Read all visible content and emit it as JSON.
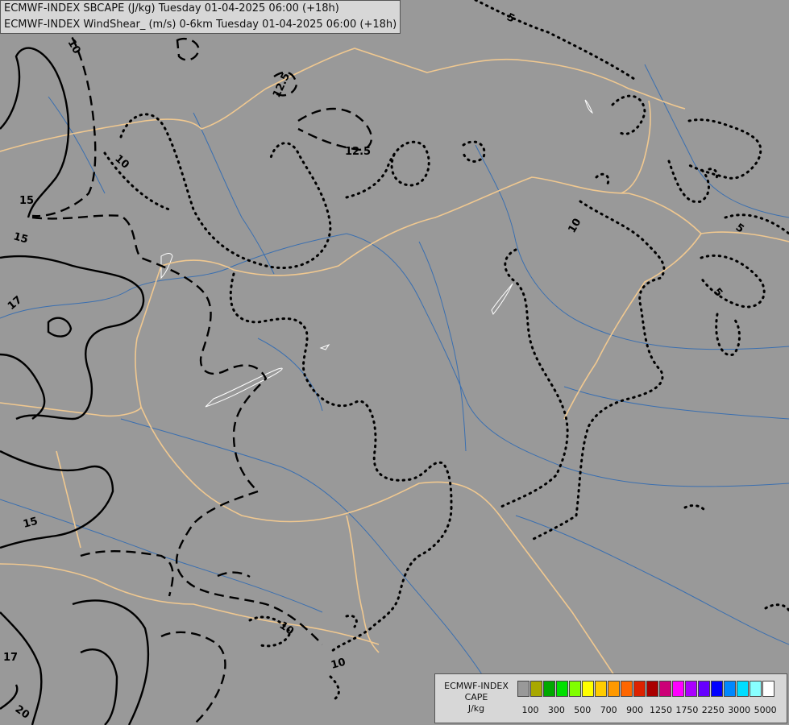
{
  "title": {
    "line1": "ECMWF-INDEX SBCAPE (J/kg) Tuesday 01-04-2025 06:00 (+18h)",
    "line2": "ECMWF-INDEX WindShear_ (m/s) 0-6km Tuesday 01-04-2025 06:00 (+18h)"
  },
  "legend": {
    "title_line1": "ECMWF-INDEX",
    "title_line2": "CAPE",
    "unit": "J/kg",
    "colors": [
      "#999999",
      "#a8a800",
      "#00a800",
      "#00e000",
      "#80ff00",
      "#ffff00",
      "#ffcc00",
      "#ff9900",
      "#ff6600",
      "#dd2200",
      "#aa0000",
      "#cc0077",
      "#ff00ff",
      "#aa00ff",
      "#6600ff",
      "#0000ff",
      "#0088ff",
      "#00ddff",
      "#88ffff",
      "#ffffff"
    ],
    "ticks": [
      "100",
      "300",
      "500",
      "700",
      "900",
      "1250",
      "1750",
      "2250",
      "3000",
      "5000"
    ]
  },
  "contour_labels": [
    "5",
    "12.5",
    "10",
    "12.5",
    "15",
    "15",
    "17",
    "15",
    "10",
    "10",
    "5",
    "5",
    "10",
    "17",
    "20",
    "10"
  ],
  "colors": {
    "background": "#999999",
    "borders": "#f0c890",
    "rivers": "#3a6fb0",
    "shear": "#000000",
    "lakes": "#ffffff"
  }
}
